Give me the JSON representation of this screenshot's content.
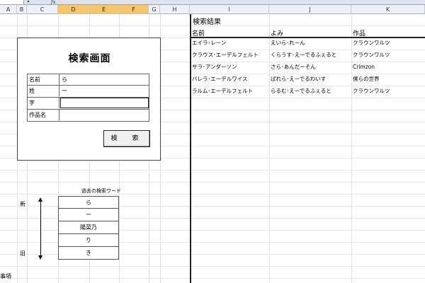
{
  "formula_bar": {
    "fx_label": "fx",
    "dropdown_icon": "triangle-down-icon"
  },
  "columns": [
    {
      "label": "A",
      "selected": false
    },
    {
      "label": "B",
      "selected": false
    },
    {
      "label": "C",
      "selected": false
    },
    {
      "label": "D",
      "selected": true
    },
    {
      "label": "E",
      "selected": true
    },
    {
      "label": "F",
      "selected": true
    },
    {
      "label": "G",
      "selected": false
    },
    {
      "label": "H",
      "selected": false
    },
    {
      "label": "I",
      "selected": false
    },
    {
      "label": "J",
      "selected": false
    },
    {
      "label": "K",
      "selected": false
    }
  ],
  "search_panel": {
    "title": "検索画面",
    "fields": [
      {
        "label": "名前",
        "value": "ら"
      },
      {
        "label": "姓",
        "value": "ー"
      },
      {
        "label": "字",
        "value": ""
      },
      {
        "label": "作品名",
        "value": ""
      }
    ],
    "button_label": "検　索"
  },
  "history": {
    "title": "過去の検索ワード",
    "new_label": "新",
    "old_label": "旧",
    "items": [
      "ら",
      "ー",
      "陽菜乃",
      "り",
      "き"
    ]
  },
  "notes_label": "事項",
  "results": {
    "title": "検索結果",
    "headers": [
      "名前",
      "よみ",
      "作品"
    ],
    "rows": [
      [
        "エイラ･レーン",
        "えいら･れーん",
        "クラウンワルツ"
      ],
      [
        "クラウス･エーデルフェルト",
        "くらうす･えーでるふぇると",
        "クラウンワルツ"
      ],
      [
        "サラ･アンダーソン",
        "さら･あんだーそん",
        "Crimzon"
      ],
      [
        "バレラ･エーデルワイス",
        "ばれら･えーでるわいす",
        "僕らの世界"
      ],
      [
        "ラルム･エーデルフェルト",
        "らるむ･えーでるふぇると",
        "クラウンワルツ"
      ]
    ]
  }
}
